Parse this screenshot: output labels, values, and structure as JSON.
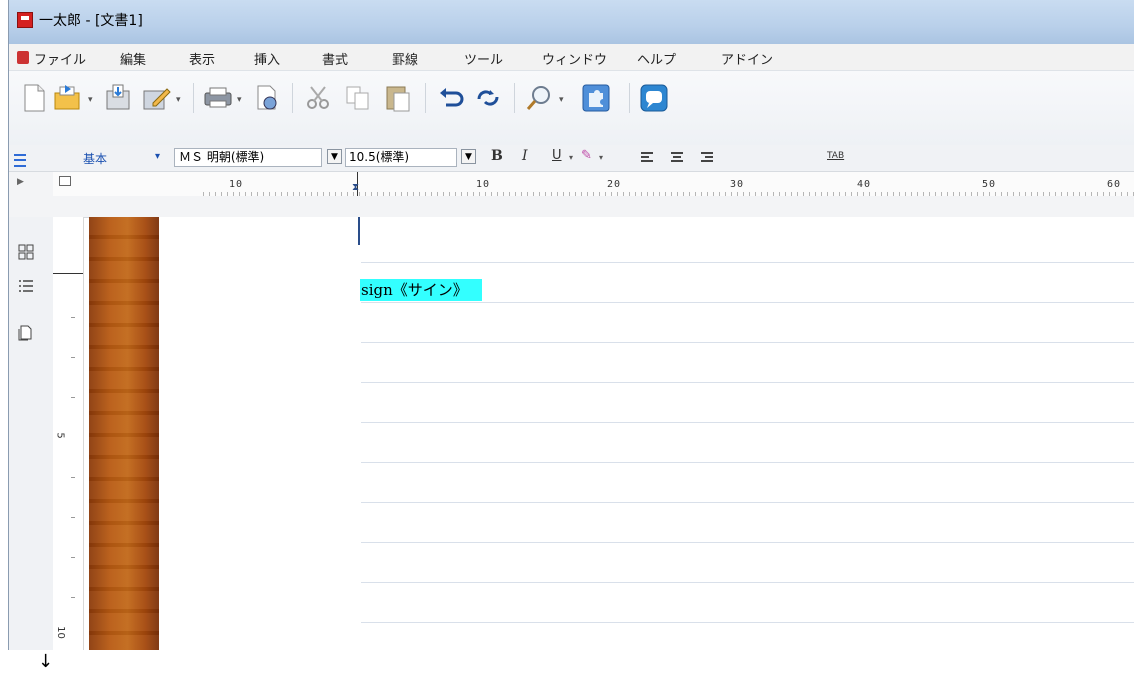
{
  "window": {
    "title": "一太郎 - [文書1]"
  },
  "menu": {
    "items": [
      {
        "label": "ファイル"
      },
      {
        "label": "編集"
      },
      {
        "label": "表示"
      },
      {
        "label": "挿入"
      },
      {
        "label": "書式"
      },
      {
        "label": "罫線"
      },
      {
        "label": "ツール"
      },
      {
        "label": "ウィンドウ"
      },
      {
        "label": "ヘルプ"
      },
      {
        "label": "アドイン"
      }
    ]
  },
  "toolbar": {
    "icons": [
      "new-document-icon",
      "open-icon",
      "save-icon",
      "edit-icon",
      "print-icon",
      "print-preview-icon",
      "cut-icon",
      "copy-icon",
      "paste-icon",
      "undo-icon",
      "redo-icon",
      "search-icon",
      "puzzle-icon",
      "help-icon"
    ]
  },
  "format": {
    "style": "基本",
    "font": "ＭＳ 明朝(標準)",
    "size": "10.5(標準)",
    "bold": "B",
    "italic": "I",
    "underline": "U",
    "tab": "TAB",
    "dropdown_glyph": "▾"
  },
  "ruler": {
    "h_labels": [
      "10",
      "10",
      "20",
      "30",
      "40",
      "50",
      "60"
    ],
    "v_labels": [
      "5",
      "10"
    ]
  },
  "document": {
    "text": "sign《サイン》",
    "highlight_color": "#33ffff"
  },
  "footer": {
    "arrow": "↓"
  }
}
